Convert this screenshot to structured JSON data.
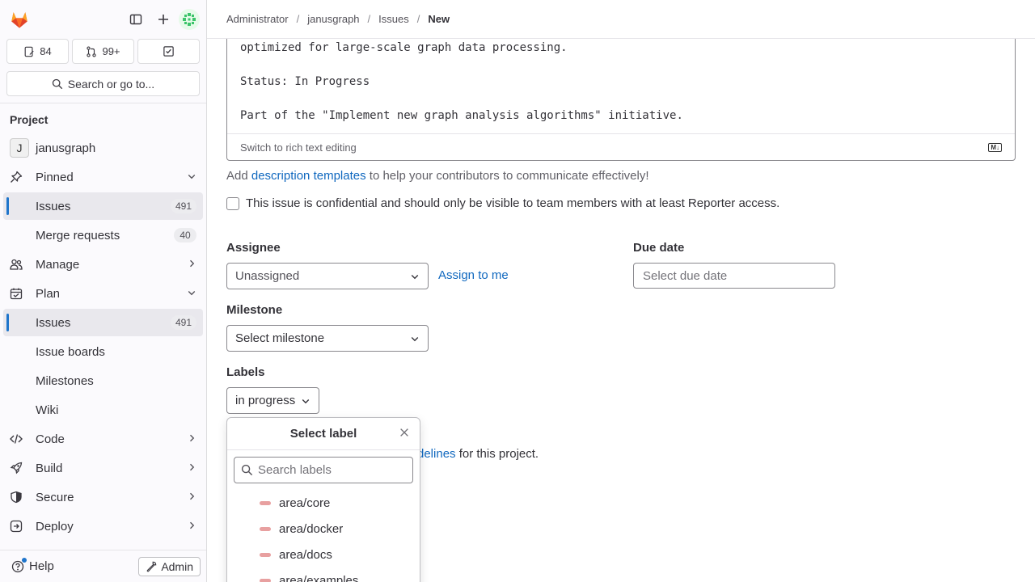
{
  "colors": {
    "label_swatch": "#e8a0a0",
    "link": "#1068bf",
    "active_indicator": "#1f75cb"
  },
  "sidebar": {
    "counts": {
      "issues": "84",
      "merge_requests": "99+"
    },
    "search_label": "Search or go to...",
    "section_heading": "Project",
    "project": {
      "avatar_letter": "J",
      "name": "janusgraph"
    },
    "pinned": {
      "label": "Pinned",
      "items": [
        {
          "label": "Issues",
          "badge": "491"
        },
        {
          "label": "Merge requests",
          "badge": "40"
        }
      ]
    },
    "manage": "Manage",
    "plan": {
      "label": "Plan",
      "items": [
        {
          "label": "Issues",
          "badge": "491"
        },
        {
          "label": "Issue boards"
        },
        {
          "label": "Milestones"
        },
        {
          "label": "Wiki"
        }
      ]
    },
    "code": "Code",
    "build": "Build",
    "secure": "Secure",
    "deploy": "Deploy",
    "help": "Help",
    "admin": "Admin"
  },
  "breadcrumb": [
    "Administrator",
    "janusgraph",
    "Issues",
    "New"
  ],
  "editor": {
    "lines": [
      "optimized for large-scale graph data processing.",
      "",
      "Status: In Progress",
      "",
      "Part of the \"Implement new graph analysis algorithms\" initiative."
    ],
    "switch_label": "Switch to rich text editing",
    "markdown_badge": "M↓"
  },
  "templates": {
    "prefix": "Add ",
    "link": "description templates",
    "suffix": " to help your contributors to communicate effectively!"
  },
  "confidential_label": "This issue is confidential and should only be visible to team members with at least Reporter access.",
  "assignee": {
    "label": "Assignee",
    "value": "Unassigned",
    "assign_me": "Assign to me"
  },
  "due_date": {
    "label": "Due date",
    "placeholder": "Select due date"
  },
  "milestone": {
    "label": "Milestone",
    "value": "Select milestone"
  },
  "labels": {
    "label": "Labels",
    "value": "in progress"
  },
  "guidelines": {
    "link": "delines",
    "suffix": " for this project."
  },
  "label_dropdown": {
    "title": "Select label",
    "search_placeholder": "Search labels",
    "items": [
      "area/core",
      "area/docker",
      "area/docs",
      "area/examples"
    ]
  }
}
